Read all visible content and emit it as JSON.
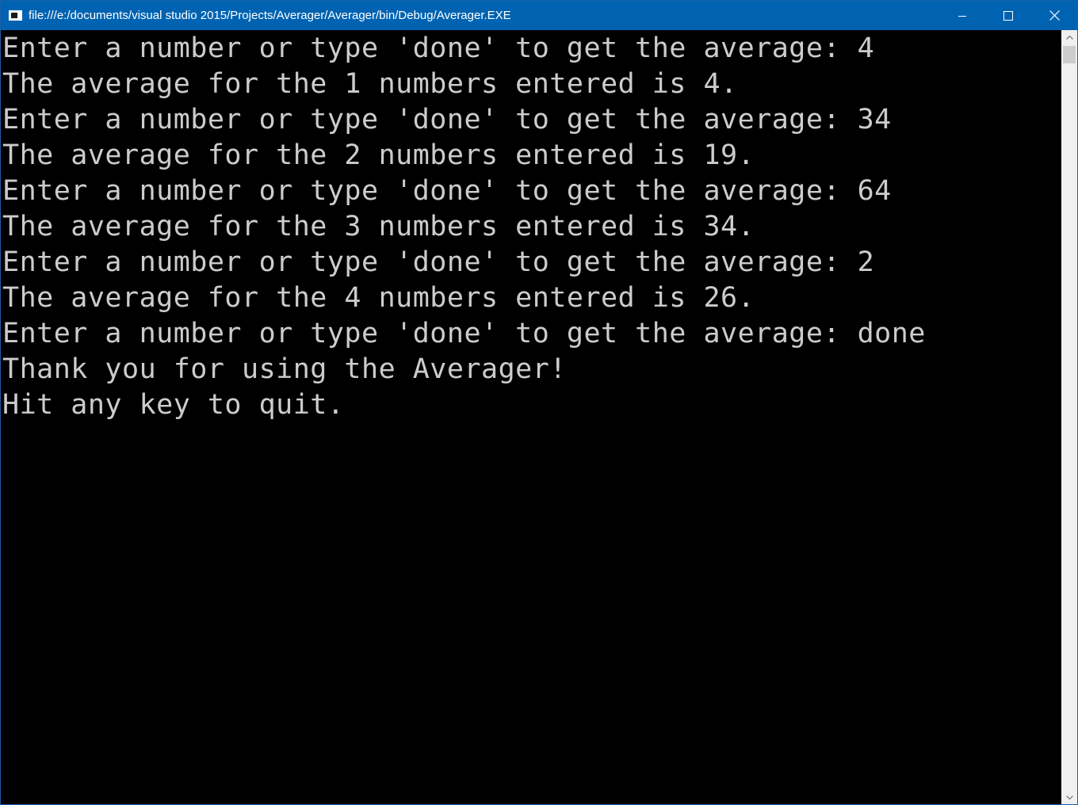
{
  "window": {
    "title": "file:///e:/documents/visual studio 2015/Projects/Averager/Averager/bin/Debug/Averager.EXE",
    "icon": "console-app-icon"
  },
  "caption_buttons": {
    "minimize": "minimize-icon",
    "maximize": "maximize-icon",
    "close": "close-icon"
  },
  "console": {
    "lines": [
      "Enter a number or type 'done' to get the average: 4",
      "The average for the 1 numbers entered is 4.",
      "Enter a number or type 'done' to get the average: 34",
      "The average for the 2 numbers entered is 19.",
      "Enter a number or type 'done' to get the average: 64",
      "The average for the 3 numbers entered is 34.",
      "Enter a number or type 'done' to get the average: 2",
      "The average for the 4 numbers entered is 26.",
      "Enter a number or type 'done' to get the average: done",
      "Thank you for using the Averager!",
      "Hit any key to quit."
    ]
  },
  "colors": {
    "titlebar": "#0063b1",
    "console_bg": "#000000",
    "console_text": "#cccccc"
  }
}
